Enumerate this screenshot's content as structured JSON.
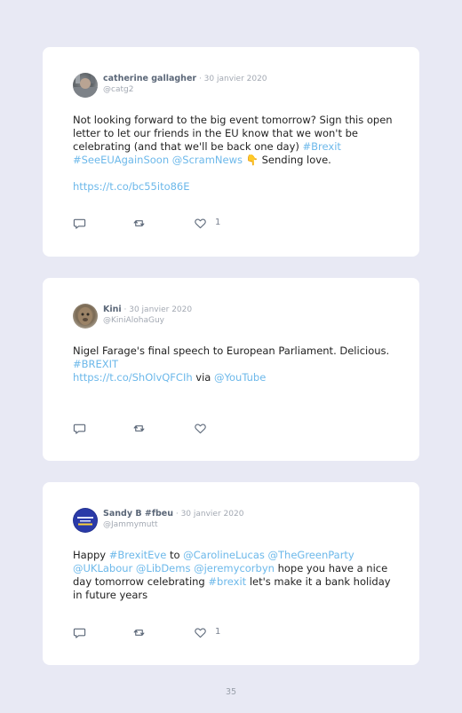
{
  "tweets": [
    {
      "author": "catherine gallagher",
      "separator": " · ",
      "date": "30 janvier 2020",
      "handle": "@catg2",
      "text": {
        "p1": "Not looking forward to the big event tomorrow? Sign this open letter to let our friends in the EU know that we won't be celebrating (and that we'll be back one day) ",
        "tag1": "#Brexit",
        "tag2": "#SeeEUAgainSoon",
        "mention1": "@ScramNews",
        "emoji": "👇",
        "p2": " Sending love.",
        "url": "https://t.co/bc55ito86E"
      },
      "like_count": "1"
    },
    {
      "author": "Kini",
      "separator": " · ",
      "date": "30 janvier 2020",
      "handle": "@KiniAlohaGuy",
      "text": {
        "p1": "Nigel Farage's final speech to European Parliament. Delicious.",
        "tag1": "#BREXIT",
        "url": "https://t.co/ShOlvQFCIh",
        "via": " via ",
        "mention1": "@YouTube"
      },
      "like_count": ""
    },
    {
      "author": "Sandy B #fbeu",
      "separator": " · ",
      "date": "30 janvier 2020",
      "handle": "@Jammymutt",
      "text": {
        "p1": "Happy ",
        "tag1": "#BrexitEve",
        "to": " to ",
        "mention1": "@CarolineLucas",
        "mention2": "@TheGreenParty",
        "mention3": "@UKLabour",
        "mention4": "@LibDems",
        "mention5": "@jeremycorbyn",
        "p2": " hope you have a nice day tomorrow celebrating ",
        "tag2": "#brexit",
        "p3": " let's make it a bank holiday in future years"
      },
      "like_count": "1"
    }
  ],
  "page_number": "35",
  "colors": {
    "background": "#e8e9f4",
    "card": "#ffffff",
    "link": "#6cb8ea",
    "author": "#5b6778",
    "muted": "#a3a9b3"
  },
  "icons": [
    "reply-icon",
    "retweet-icon",
    "heart-icon"
  ]
}
